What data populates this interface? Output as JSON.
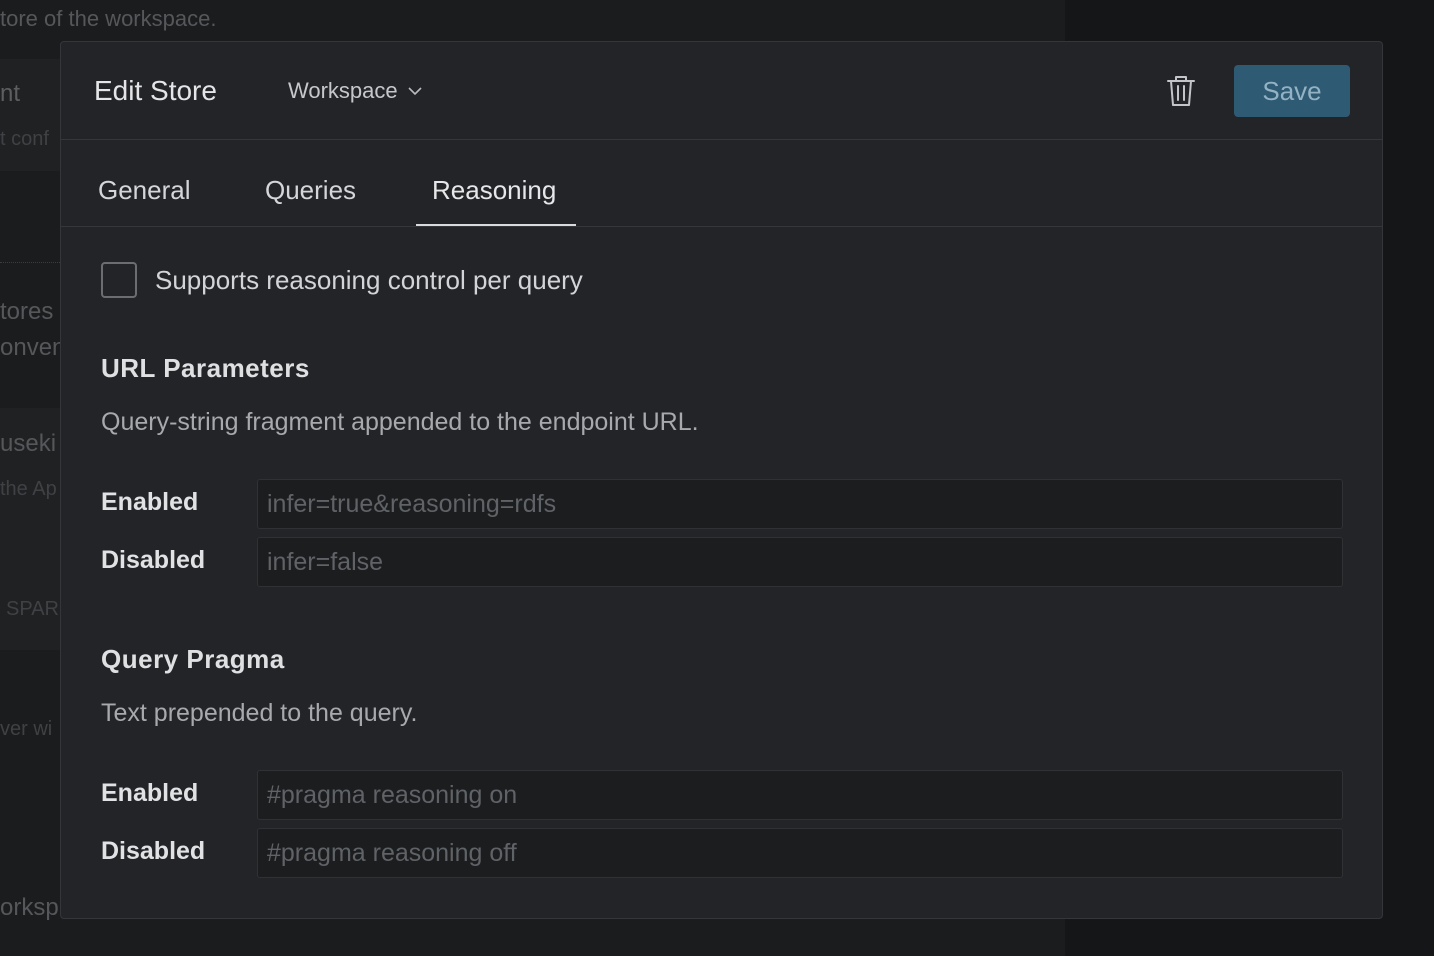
{
  "background": {
    "fragments": [
      "tore of the workspace.",
      "nt",
      "t conf",
      "tores",
      "onven",
      "useki",
      "the Ap",
      "SPAR",
      "ver wi",
      "orksp"
    ]
  },
  "modal": {
    "title": "Edit Store",
    "workspace_label": "Workspace",
    "save_label": "Save",
    "tabs": [
      {
        "label": "General",
        "active": false
      },
      {
        "label": "Queries",
        "active": false
      },
      {
        "label": "Reasoning",
        "active": true
      }
    ],
    "reasoning_checkbox": {
      "label": "Supports reasoning control per query",
      "checked": false
    },
    "url_params": {
      "title": "URL Parameters",
      "description": "Query-string fragment appended to the endpoint URL.",
      "enabled_label": "Enabled",
      "enabled_placeholder": "infer=true&reasoning=rdfs",
      "disabled_label": "Disabled",
      "disabled_placeholder": "infer=false"
    },
    "query_pragma": {
      "title": "Query Pragma",
      "description": "Text prepended to the query.",
      "enabled_label": "Enabled",
      "enabled_placeholder": "#pragma reasoning on",
      "disabled_label": "Disabled",
      "disabled_placeholder": "#pragma reasoning off"
    }
  },
  "colors": {
    "accent": "#2f5a73",
    "modal_bg": "#232427",
    "page_bg": "#151617"
  }
}
